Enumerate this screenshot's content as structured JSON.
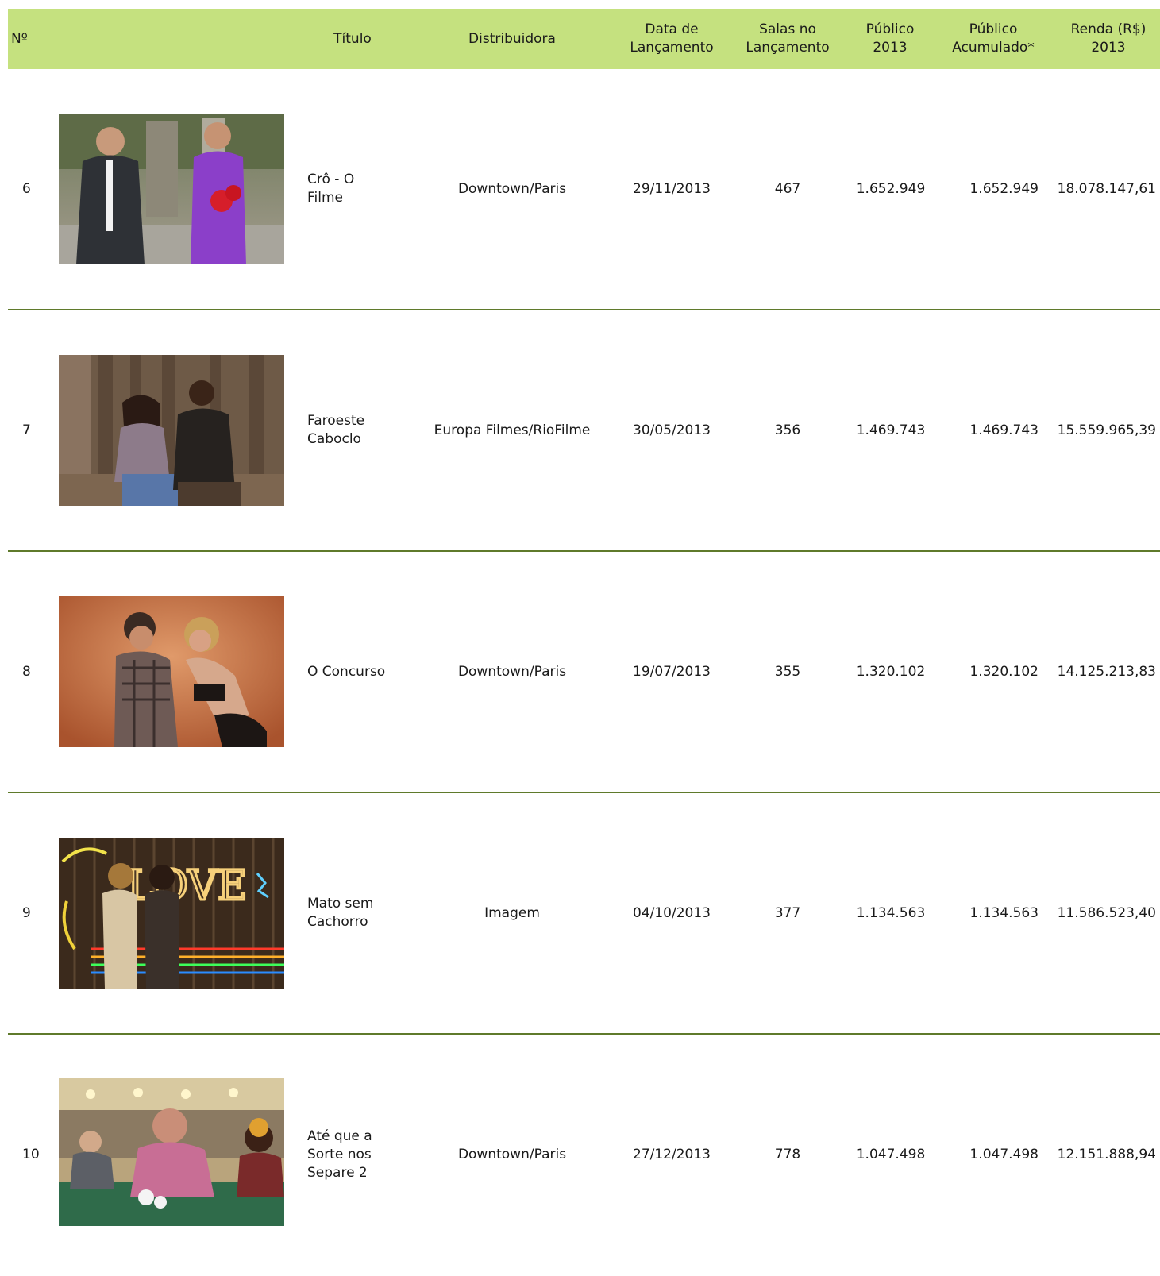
{
  "header": {
    "num": "Nº",
    "titulo": "Título",
    "distribuidora": "Distribuidora",
    "data_lancamento": "Data de\nLançamento",
    "salas": "Salas no\nLançamento",
    "publico_2013": "Público\n2013",
    "publico_acumulado": "Público\nAcumulado*",
    "renda": "Renda (R$)\n2013"
  },
  "rows": [
    {
      "num": "6",
      "title": "Crô - O\nFilme",
      "distribuidora": "Downtown/Paris",
      "data": "29/11/2013",
      "salas": "467",
      "publico_2013": "1.652.949",
      "publico_acumulado": "1.652.949",
      "renda": "18.078.147,61",
      "image_icon": "film-still-image"
    },
    {
      "num": "7",
      "title": "Faroeste\nCaboclo",
      "distribuidora": "Europa Filmes/RioFilme",
      "data": "30/05/2013",
      "salas": "356",
      "publico_2013": "1.469.743",
      "publico_acumulado": "1.469.743",
      "renda": "15.559.965,39",
      "image_icon": "film-still-image"
    },
    {
      "num": "8",
      "title": "O Concurso",
      "distribuidora": "Downtown/Paris",
      "data": "19/07/2013",
      "salas": "355",
      "publico_2013": "1.320.102",
      "publico_acumulado": "1.320.102",
      "renda": "14.125.213,83",
      "image_icon": "film-still-image"
    },
    {
      "num": "9",
      "title": "Mato sem\nCachorro",
      "distribuidora": "Imagem",
      "data": "04/10/2013",
      "salas": "377",
      "publico_2013": "1.134.563",
      "publico_acumulado": "1.134.563",
      "renda": "11.586.523,40",
      "image_icon": "film-still-image"
    },
    {
      "num": "10",
      "title": "Até que a\nSorte nos\nSepare 2",
      "distribuidora": "Downtown/Paris",
      "data": "27/12/2013",
      "salas": "778",
      "publico_2013": "1.047.498",
      "publico_acumulado": "1.047.498",
      "renda": "12.151.888,94",
      "image_icon": "film-still-image"
    }
  ],
  "colors": {
    "header_bg": "#c5e17f",
    "separator": "#5f7a2b",
    "text": "#1a1a1a"
  }
}
